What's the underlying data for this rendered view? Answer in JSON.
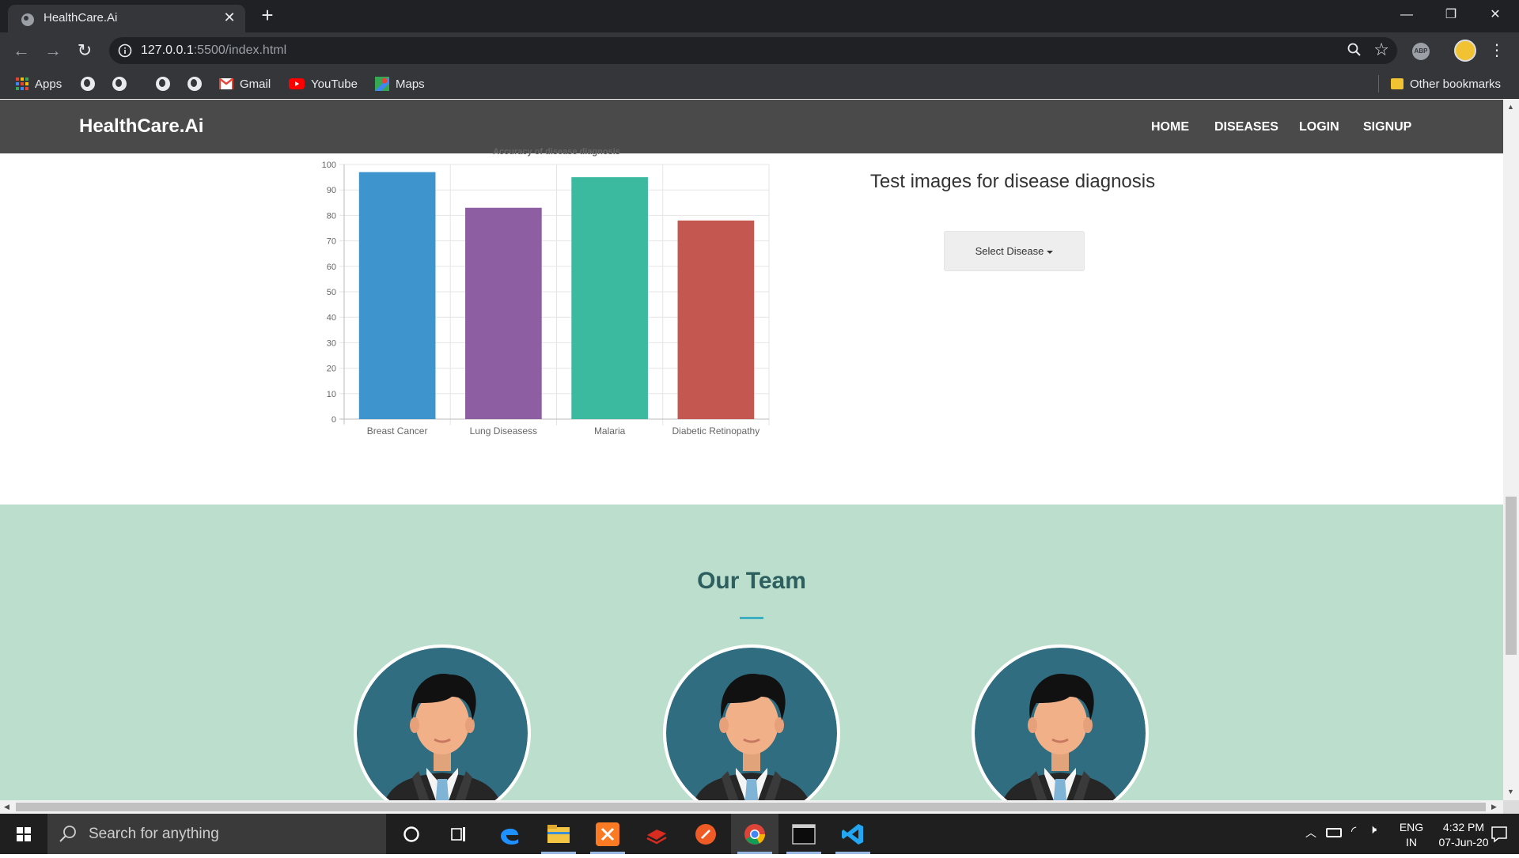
{
  "browser": {
    "tab_title": "HealthCare.Ai",
    "tab_close": "✕",
    "new_tab": "+",
    "url_host": "127.0.0.1",
    "url_rest": ":5500/index.html",
    "window_controls": {
      "minimize": "—",
      "restore": "❐",
      "close": "✕"
    }
  },
  "bookmarks": {
    "apps": "Apps",
    "gmail": "Gmail",
    "youtube": "YouTube",
    "maps": "Maps",
    "other": "Other bookmarks"
  },
  "site": {
    "brand": "HealthCare.Ai",
    "nav": [
      "HOME",
      "DISEASES",
      "LOGIN",
      "SIGNUP"
    ]
  },
  "chart_data": {
    "type": "bar",
    "title": "Accuracy of disease diagnosis",
    "categories": [
      "Breast Cancer",
      "Lung Diseasess",
      "Malaria",
      "Diabetic Retinopathy"
    ],
    "values": [
      97,
      83,
      95,
      78
    ],
    "colors": [
      "#3e95cd",
      "#8e5ea2",
      "#3cba9f",
      "#c45850"
    ],
    "ylim": [
      0,
      100
    ],
    "yticks": [
      0,
      10,
      20,
      30,
      40,
      50,
      60,
      70,
      80,
      90,
      100
    ],
    "grid": true
  },
  "test_section": {
    "heading": "Test images for disease diagnosis",
    "select_label": "Select Disease"
  },
  "team": {
    "title": "Our Team",
    "members": 3
  },
  "taskbar": {
    "search_placeholder": "Search for anything",
    "lang_top": "ENG",
    "lang_bottom": "IN",
    "time": "4:32 PM",
    "date": "07-Jun-20"
  }
}
